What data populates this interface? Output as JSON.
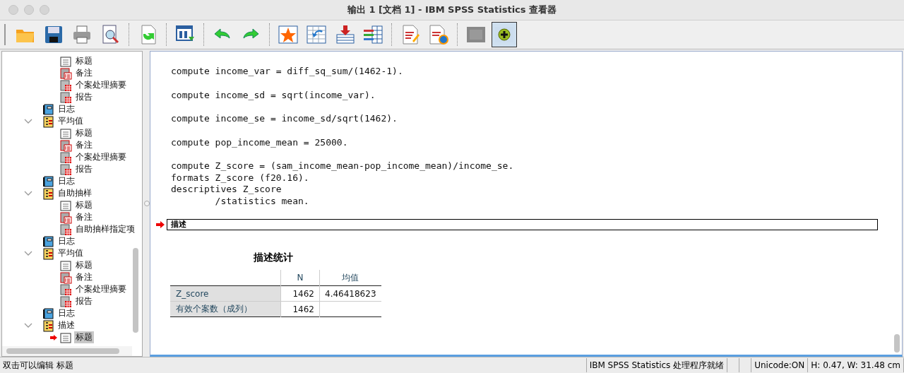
{
  "window": {
    "title": "输出 1 [文档 1] - IBM SPSS Statistics 查看器"
  },
  "toolbar": [
    {
      "kind": "open"
    },
    {
      "kind": "save"
    },
    {
      "kind": "print"
    },
    {
      "kind": "preview"
    },
    {
      "kind": "sep"
    },
    {
      "kind": "export"
    },
    {
      "kind": "sep"
    },
    {
      "kind": "data"
    },
    {
      "kind": "sep"
    },
    {
      "kind": "undo"
    },
    {
      "kind": "redo"
    },
    {
      "kind": "sep"
    },
    {
      "kind": "star"
    },
    {
      "kind": "goto"
    },
    {
      "kind": "insert"
    },
    {
      "kind": "vars"
    },
    {
      "kind": "sep"
    },
    {
      "kind": "edit"
    },
    {
      "kind": "play"
    },
    {
      "kind": "sep"
    },
    {
      "kind": "hide"
    },
    {
      "kind": "show"
    }
  ],
  "outline": [
    {
      "children": [
        {
          "kind": "title",
          "label": "标题",
          "selected": false
        },
        {
          "kind": "notes",
          "label": "备注",
          "selected": false
        },
        {
          "kind": "table",
          "label": "个案处理摘要",
          "selected": false
        },
        {
          "kind": "table",
          "label": "报告",
          "selected": false
        }
      ]
    },
    {
      "kind": "log",
      "label": "日志",
      "selected": false
    },
    {
      "kind": "procedure",
      "label": "平均值",
      "expanded": true,
      "selected": false,
      "children": [
        {
          "kind": "title",
          "label": "标题",
          "selected": false
        },
        {
          "kind": "notes",
          "label": "备注",
          "selected": false
        },
        {
          "kind": "table",
          "label": "个案处理摘要",
          "selected": false
        },
        {
          "kind": "table",
          "label": "报告",
          "selected": false
        }
      ]
    },
    {
      "kind": "log",
      "label": "日志",
      "selected": false
    },
    {
      "kind": "procedure",
      "label": "自助抽样",
      "expanded": true,
      "selected": false,
      "children": [
        {
          "kind": "title",
          "label": "标题",
          "selected": false
        },
        {
          "kind": "notes",
          "label": "备注",
          "selected": false
        },
        {
          "kind": "table",
          "label": "自助抽样指定项",
          "selected": false
        }
      ]
    },
    {
      "kind": "log",
      "label": "日志",
      "selected": false
    },
    {
      "kind": "procedure",
      "label": "平均值",
      "expanded": true,
      "selected": false,
      "children": [
        {
          "kind": "title",
          "label": "标题",
          "selected": false
        },
        {
          "kind": "notes",
          "label": "备注",
          "selected": false
        },
        {
          "kind": "table",
          "label": "个案处理摘要",
          "selected": false
        },
        {
          "kind": "table",
          "label": "报告",
          "selected": false
        }
      ]
    },
    {
      "kind": "log",
      "label": "日志",
      "selected": false
    },
    {
      "kind": "procedure",
      "label": "描述",
      "expanded": true,
      "selected": false,
      "children": [
        {
          "kind": "title",
          "label": "标题",
          "selected": true
        }
      ]
    }
  ],
  "syntax": [
    [
      "compute income_var = diff_sq_sum/(1462-1)."
    ],
    [
      "compute income_sd = sqrt(income_var)."
    ],
    [
      "compute income_se = income_sd/sqrt(1462)."
    ],
    [
      "compute pop_income_mean = 25000."
    ],
    [
      "compute Z_score = (sam_income_mean-pop_income_mean)/income_se.",
      "formats Z_score (f20.16).",
      "descriptives Z_score",
      "        /statistics mean."
    ]
  ],
  "heading": {
    "text": "描述",
    "selected": true
  },
  "table": {
    "title": "描述统计",
    "columns": [
      "N",
      "均值"
    ],
    "rows": [
      {
        "label": "Z_score",
        "cells": [
          "1462",
          "4.46418623"
        ]
      },
      {
        "label": "有效个案数（成列）",
        "cells": [
          "1462"
        ]
      }
    ]
  },
  "status_bar": {
    "message": "双击可以编辑 标题",
    "processor": "IBM SPSS Statistics 处理程序就绪",
    "unicode": "Unicode:ON",
    "size": "H: 0.47, W: 31.48 cm"
  }
}
